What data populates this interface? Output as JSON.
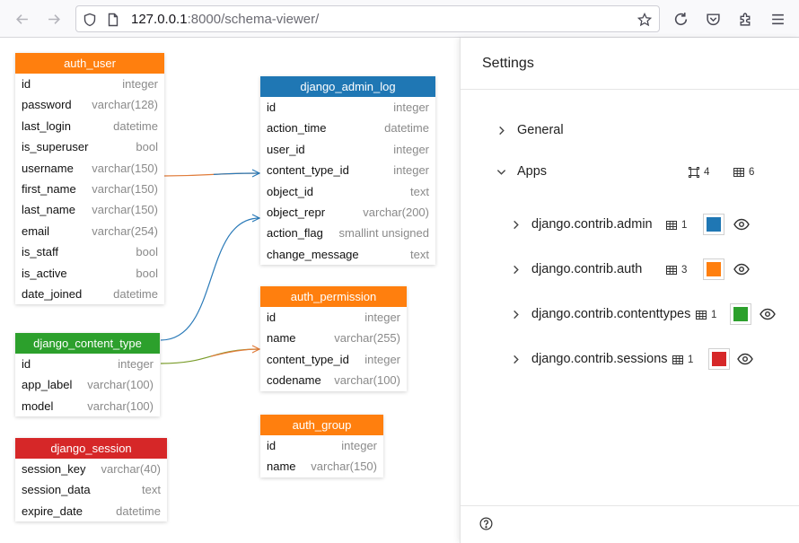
{
  "browser": {
    "url_host": "127.0.0.1",
    "url_rest": ":8000/schema-viewer/"
  },
  "colors": {
    "orange": "#ff7f0e",
    "blue": "#1f77b4",
    "green": "#2ca02c",
    "red": "#d62728"
  },
  "tables": {
    "auth_user": {
      "name": "auth_user",
      "rows": [
        {
          "name": "id",
          "type": "integer"
        },
        {
          "name": "password",
          "type": "varchar(128)"
        },
        {
          "name": "last_login",
          "type": "datetime"
        },
        {
          "name": "is_superuser",
          "type": "bool"
        },
        {
          "name": "username",
          "type": "varchar(150)"
        },
        {
          "name": "first_name",
          "type": "varchar(150)"
        },
        {
          "name": "last_name",
          "type": "varchar(150)"
        },
        {
          "name": "email",
          "type": "varchar(254)"
        },
        {
          "name": "is_staff",
          "type": "bool"
        },
        {
          "name": "is_active",
          "type": "bool"
        },
        {
          "name": "date_joined",
          "type": "datetime"
        }
      ]
    },
    "django_admin_log": {
      "name": "django_admin_log",
      "rows": [
        {
          "name": "id",
          "type": "integer"
        },
        {
          "name": "action_time",
          "type": "datetime"
        },
        {
          "name": "user_id",
          "type": "integer"
        },
        {
          "name": "content_type_id",
          "type": "integer"
        },
        {
          "name": "object_id",
          "type": "text"
        },
        {
          "name": "object_repr",
          "type": "varchar(200)"
        },
        {
          "name": "action_flag",
          "type": "smallint unsigned"
        },
        {
          "name": "change_message",
          "type": "text"
        }
      ]
    },
    "auth_permission": {
      "name": "auth_permission",
      "rows": [
        {
          "name": "id",
          "type": "integer"
        },
        {
          "name": "name",
          "type": "varchar(255)"
        },
        {
          "name": "content_type_id",
          "type": "integer"
        },
        {
          "name": "codename",
          "type": "varchar(100)"
        }
      ]
    },
    "django_content_type": {
      "name": "django_content_type",
      "rows": [
        {
          "name": "id",
          "type": "integer"
        },
        {
          "name": "app_label",
          "type": "varchar(100)"
        },
        {
          "name": "model",
          "type": "varchar(100)"
        }
      ]
    },
    "auth_group": {
      "name": "auth_group",
      "rows": [
        {
          "name": "id",
          "type": "integer"
        },
        {
          "name": "name",
          "type": "varchar(150)"
        }
      ]
    },
    "django_session": {
      "name": "django_session",
      "rows": [
        {
          "name": "session_key",
          "type": "varchar(40)"
        },
        {
          "name": "session_data",
          "type": "text"
        },
        {
          "name": "expire_date",
          "type": "datetime"
        }
      ]
    }
  },
  "settings": {
    "title": "Settings",
    "general_label": "General",
    "apps_label": "Apps",
    "apps_model_count": "4",
    "apps_table_count": "6",
    "apps": [
      {
        "label": "django.contrib.admin",
        "count": "1",
        "color": "#1f77b4"
      },
      {
        "label": "django.contrib.auth",
        "count": "3",
        "color": "#ff7f0e"
      },
      {
        "label": "django.contrib.contenttypes",
        "count": "1",
        "color": "#2ca02c"
      },
      {
        "label": "django.contrib.sessions",
        "count": "1",
        "color": "#d62728"
      }
    ]
  }
}
